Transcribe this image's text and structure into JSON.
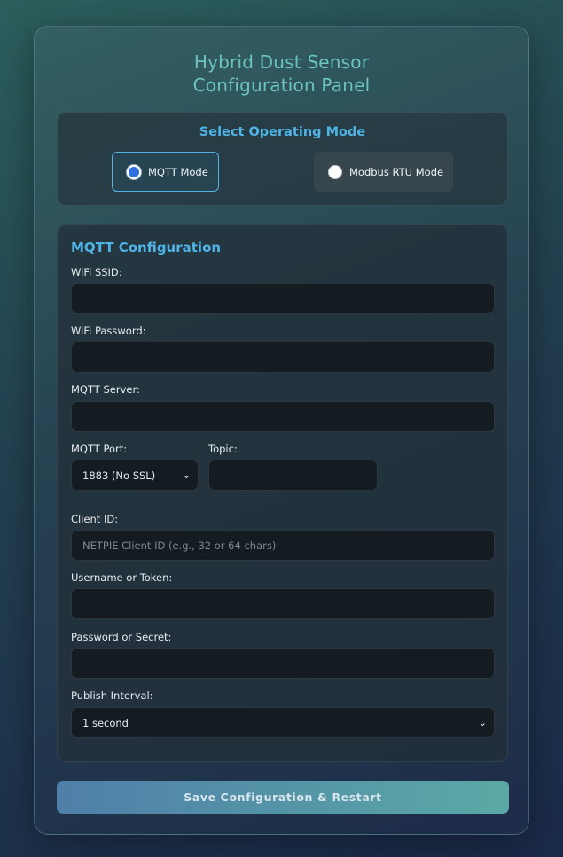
{
  "header": {
    "title_line1": "Hybrid Dust Sensor",
    "title_line2": "Configuration Panel"
  },
  "mode": {
    "heading": "Select Operating Mode",
    "options": [
      {
        "label": "MQTT Mode",
        "selected": true
      },
      {
        "label": "Modbus RTU Mode",
        "selected": false
      }
    ]
  },
  "mqtt": {
    "heading": "MQTT Configuration",
    "wifi_ssid": {
      "label": "WiFi SSID:",
      "value": "",
      "placeholder": ""
    },
    "wifi_password": {
      "label": "WiFi Password:",
      "value": "",
      "placeholder": ""
    },
    "server": {
      "label": "MQTT Server:",
      "value": "",
      "placeholder": ""
    },
    "port": {
      "label": "MQTT Port:",
      "selected": "1883 (No SSL)"
    },
    "topic": {
      "label": "Topic:",
      "value": "",
      "placeholder": ""
    },
    "client_id": {
      "label": "Client ID:",
      "value": "",
      "placeholder": "NETPIE Client ID (e.g., 32 or 64 chars)"
    },
    "username": {
      "label": "Username or Token:",
      "value": "",
      "placeholder": ""
    },
    "password": {
      "label": "Password or Secret:",
      "value": "",
      "placeholder": ""
    },
    "interval": {
      "label": "Publish Interval:",
      "selected": "1 second"
    }
  },
  "actions": {
    "save_label": "Save Configuration & Restart"
  },
  "colors": {
    "accent": "#4fb3e6",
    "title": "#6cc4c0",
    "radio_selected": "#2f6fe0"
  }
}
